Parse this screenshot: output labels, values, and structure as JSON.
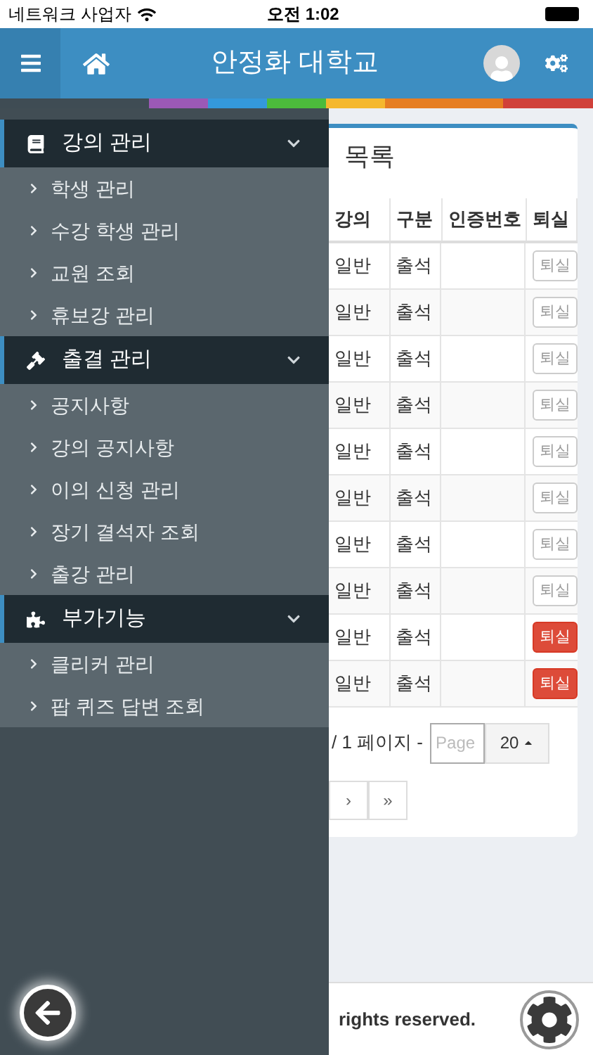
{
  "status_bar": {
    "carrier": "네트워크 사업자",
    "time": "오전 1:02"
  },
  "header": {
    "title": "안정화 대학교"
  },
  "sidebar": {
    "sections": [
      {
        "title": "강의 관리",
        "expanded": true,
        "items": [
          "학생 관리",
          "수강 학생 관리",
          "교원 조회",
          "휴보강 관리"
        ]
      },
      {
        "title": "출결 관리",
        "expanded": true,
        "items": [
          "공지사항",
          "강의 공지사항",
          "이의 신청 관리",
          "장기 결석자 조회",
          "출강 관리"
        ]
      },
      {
        "title": "부가기능",
        "expanded": true,
        "items": [
          "클리커 관리",
          "팝 퀴즈 답변 조회"
        ]
      }
    ]
  },
  "content": {
    "title_fragment": "목록",
    "table": {
      "columns": [
        "강의",
        "구분",
        "인증번호",
        "퇴실"
      ],
      "rows": [
        {
          "cells": [
            "일반",
            "출석",
            ""
          ],
          "action": {
            "label": "퇴실",
            "highlighted": false
          }
        },
        {
          "cells": [
            "일반",
            "출석",
            ""
          ],
          "action": {
            "label": "퇴실",
            "highlighted": false
          }
        },
        {
          "cells": [
            "일반",
            "출석",
            ""
          ],
          "action": {
            "label": "퇴실",
            "highlighted": false
          }
        },
        {
          "cells": [
            "일반",
            "출석",
            ""
          ],
          "action": {
            "label": "퇴실",
            "highlighted": false
          }
        },
        {
          "cells": [
            "일반",
            "출석",
            ""
          ],
          "action": {
            "label": "퇴실",
            "highlighted": false
          }
        },
        {
          "cells": [
            "일반",
            "출석",
            ""
          ],
          "action": {
            "label": "퇴실",
            "highlighted": false
          }
        },
        {
          "cells": [
            "일반",
            "출석",
            ""
          ],
          "action": {
            "label": "퇴실",
            "highlighted": false
          }
        },
        {
          "cells": [
            "일반",
            "출석",
            ""
          ],
          "action": {
            "label": "퇴실",
            "highlighted": false
          }
        },
        {
          "cells": [
            "일반",
            "출석",
            ""
          ],
          "action": {
            "label": "퇴실",
            "highlighted": true
          }
        },
        {
          "cells": [
            "일반",
            "출석",
            ""
          ],
          "action": {
            "label": "퇴실",
            "highlighted": true
          }
        }
      ]
    },
    "pagination": {
      "summary": "/ 1 페이지 -",
      "page_placeholder": "Page",
      "page_size": "20"
    },
    "pager": [
      "›",
      "»"
    ]
  },
  "footer": {
    "text": "rights reserved."
  }
}
